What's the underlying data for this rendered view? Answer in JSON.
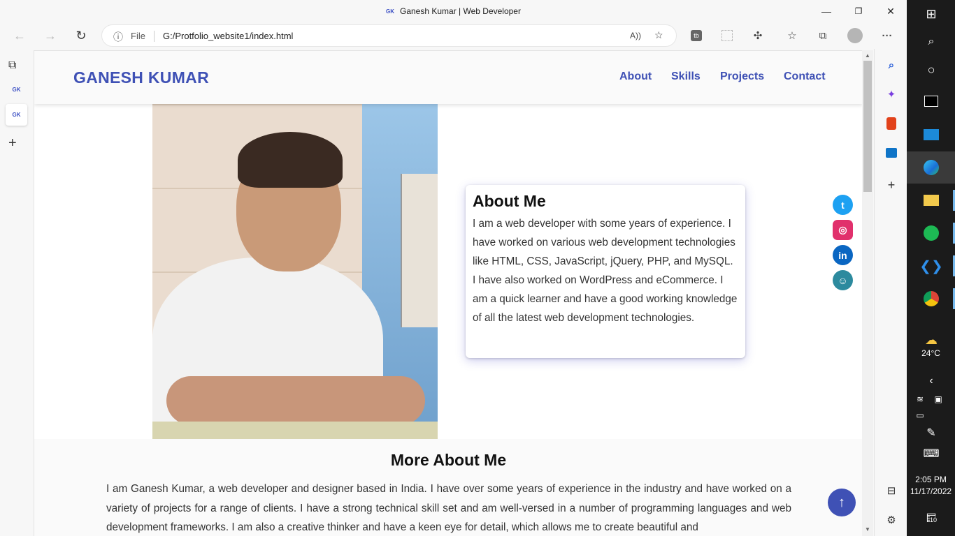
{
  "window": {
    "title": "Ganesh Kumar | Web Developer",
    "favicon_text": "GK",
    "controls": {
      "minimize": "—",
      "maximize": "❐",
      "close": "✕"
    }
  },
  "browser": {
    "address": {
      "info_icon": "ⓘ",
      "scheme_label": "File",
      "url": "G:/Protfolio_website1/index.html"
    },
    "nav_icons": {
      "back": "←",
      "forward": "→",
      "refresh": "↻"
    },
    "toolbar_icons": [
      "read-aloud-icon",
      "favorite-add-icon",
      "extension-tb-icon",
      "extension-grid-icon",
      "extensions-icon",
      "favorites-icon",
      "collections-icon",
      "profile-icon",
      "more-icon"
    ],
    "more_glyph": "···"
  },
  "tabs": {
    "tab_actions_glyph": "⧉",
    "items": [
      {
        "label": "GK"
      },
      {
        "label": "GK"
      }
    ],
    "new_tab_glyph": "+"
  },
  "site": {
    "brand": "GANESH KUMAR",
    "nav": [
      {
        "label": "About"
      },
      {
        "label": "Skills"
      },
      {
        "label": "Projects"
      },
      {
        "label": "Contact"
      }
    ],
    "about": {
      "title": "About Me",
      "text": "I am a web developer with some years of experience. I have worked on various web development technologies like HTML, CSS, JavaScript, jQuery, PHP, and MySQL. I have also worked on WordPress and eCommerce. I am a quick learner and have a good working knowledge of all the latest web development technologies."
    },
    "social": [
      {
        "name": "twitter-icon",
        "glyph": "t",
        "color": "#1da1f2"
      },
      {
        "name": "instagram-icon",
        "glyph": "◎",
        "color": "#e1306c"
      },
      {
        "name": "linkedin-icon",
        "glyph": "in",
        "color": "#0a66c2"
      },
      {
        "name": "github-icon",
        "glyph": "☺",
        "color": "#2c8a9e"
      }
    ],
    "more_about": {
      "title": "More About Me",
      "text": "I am Ganesh Kumar, a web developer and designer based in India. I have over some years of experience in the industry and have worked on a variety of projects for a range of clients. I have a strong technical skill set and am well-versed in a number of programming languages and web development frameworks. I am also a creative thinker and have a keen eye for detail, which allows me to create beautiful and"
    },
    "to_top_glyph": "↑"
  },
  "taskbar": {
    "weather": {
      "temp": "24°C"
    },
    "time": "2:05 PM",
    "date": "11/17/2022",
    "notifications_count": "10"
  },
  "colors": {
    "accent": "#3f51b5",
    "taskbar_bg": "#1b1b1b"
  }
}
